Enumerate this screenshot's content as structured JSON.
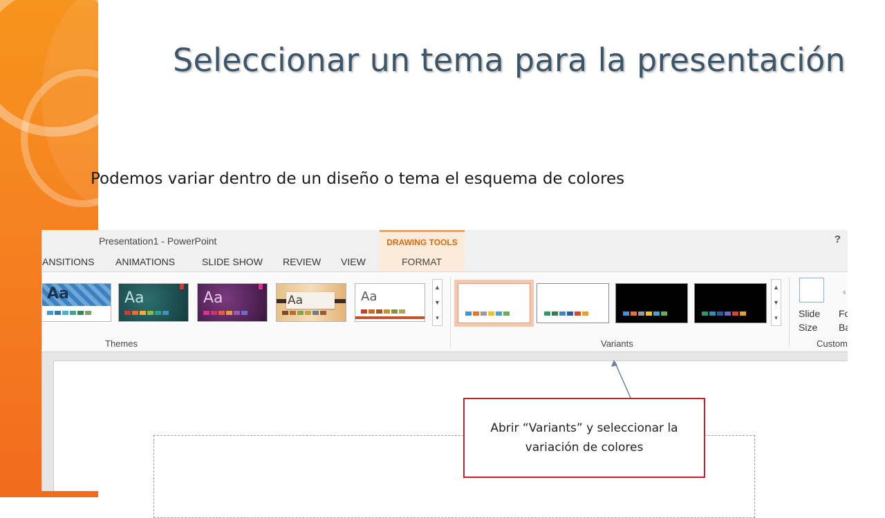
{
  "slide": {
    "title": "Seleccionar un tema para la presentación",
    "subtitle": "Podemos variar dentro de un diseño o tema el esquema de colores",
    "callout": "Abrir “Variants” y seleccionar la variación de colores"
  },
  "powerpoint": {
    "window_title": "Presentation1 - PowerPoint",
    "help": "?",
    "contextual_tab_group": "DRAWING TOOLS",
    "tabs": [
      {
        "label": "ANSITIONS"
      },
      {
        "label": "ANIMATIONS"
      },
      {
        "label": "SLIDE SHOW"
      },
      {
        "label": "REVIEW"
      },
      {
        "label": "VIEW"
      },
      {
        "label": "FORMAT"
      }
    ],
    "groups": {
      "themes": "Themes",
      "variants": "Variants",
      "customize": "Custom"
    },
    "theme_label": "Aa",
    "slide_size_label": "Slide Size",
    "format_background_label": "Fo Back",
    "colors": {
      "accent_orange": "#f58220",
      "callout_border": "#c0202a",
      "title_color": "#3d5569"
    }
  }
}
